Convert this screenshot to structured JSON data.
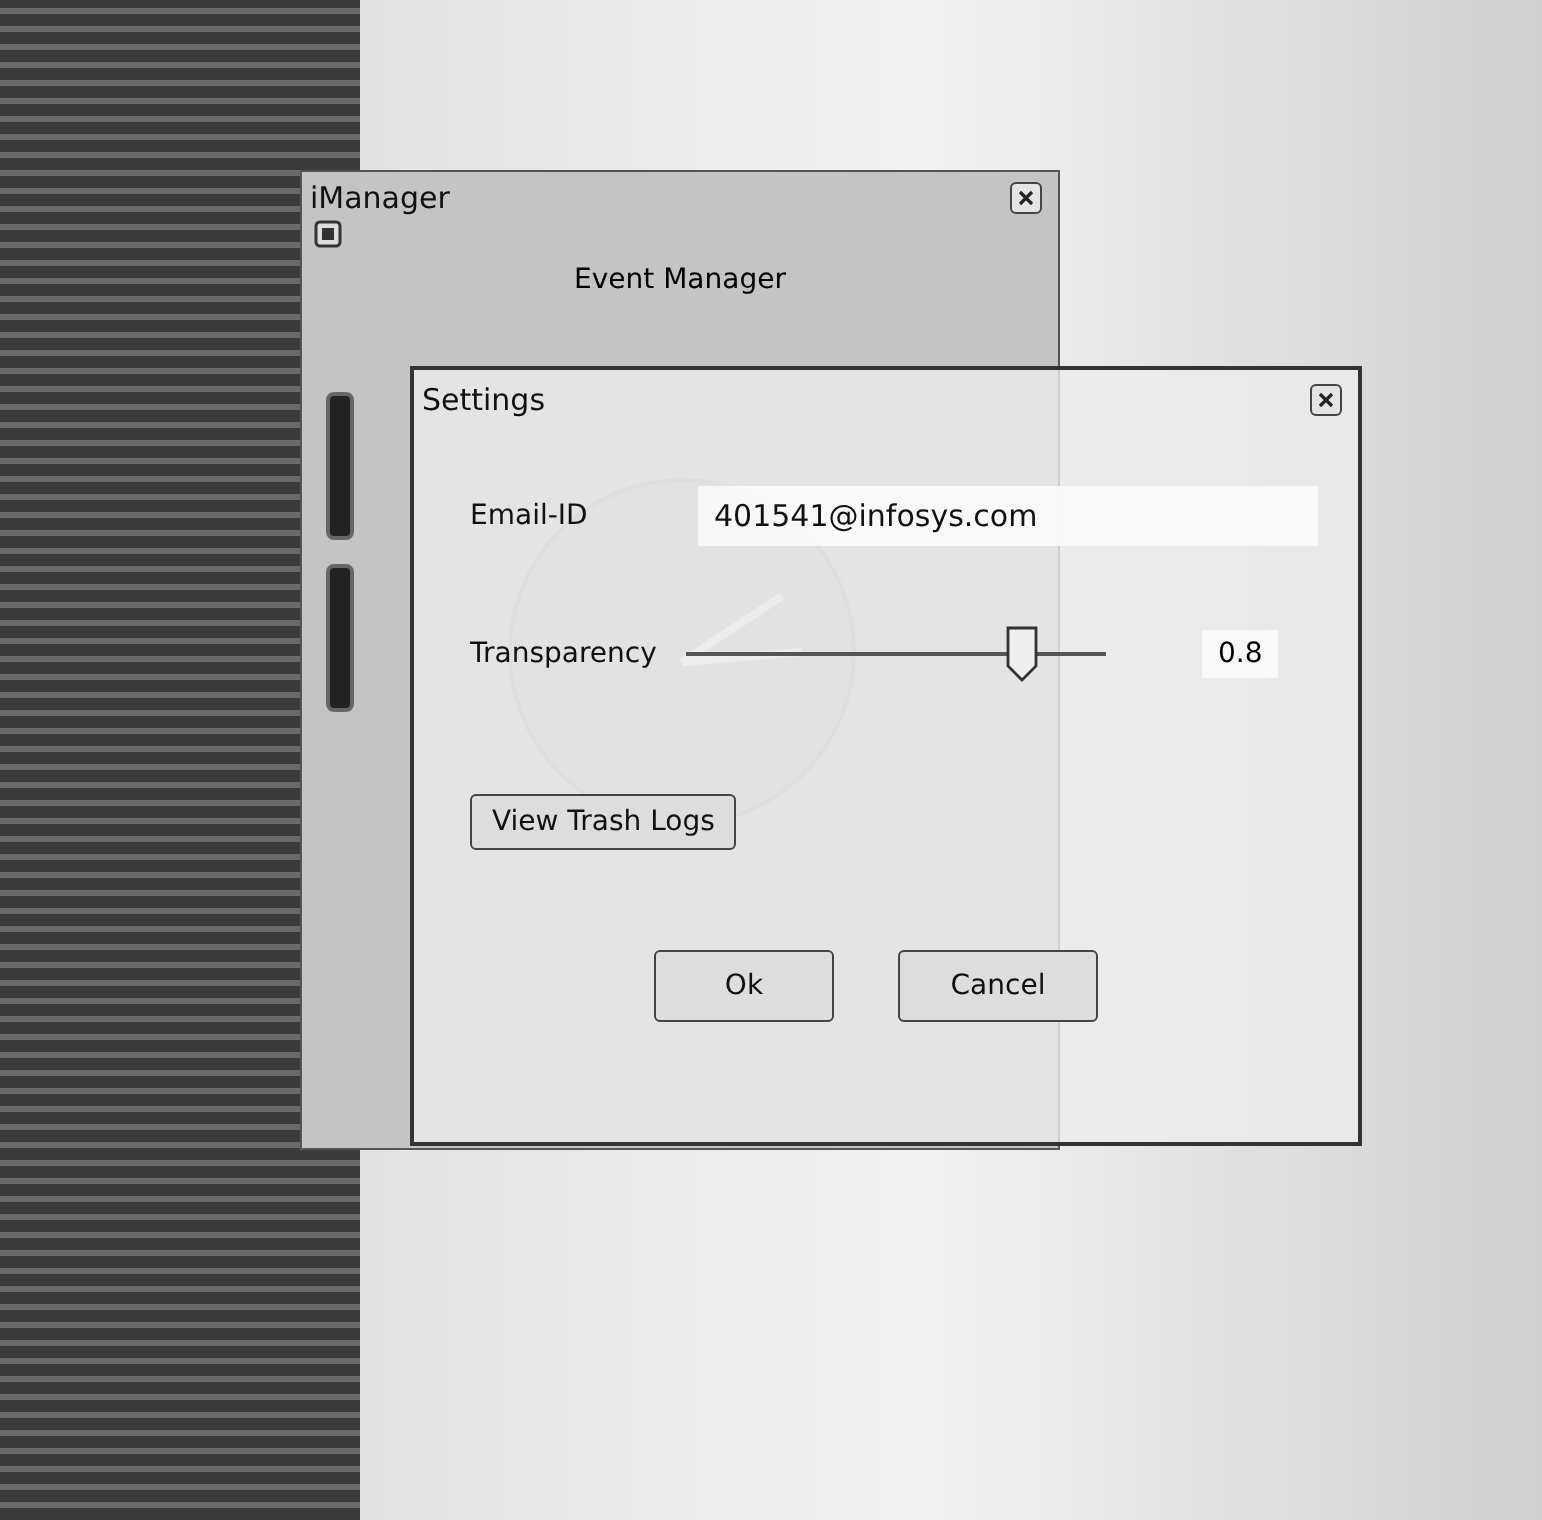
{
  "imanager": {
    "title": "iManager",
    "heading": "Event Manager"
  },
  "settings": {
    "title": "Settings",
    "email": {
      "label": "Email-ID",
      "value": "401541@infosys.com"
    },
    "transparency": {
      "label": "Transparency",
      "level": 0.8,
      "reading": "0.8"
    },
    "trash_button": "View Trash Logs",
    "buttons": [
      {
        "label": "Ok"
      },
      {
        "label": "Cancel"
      }
    ]
  }
}
